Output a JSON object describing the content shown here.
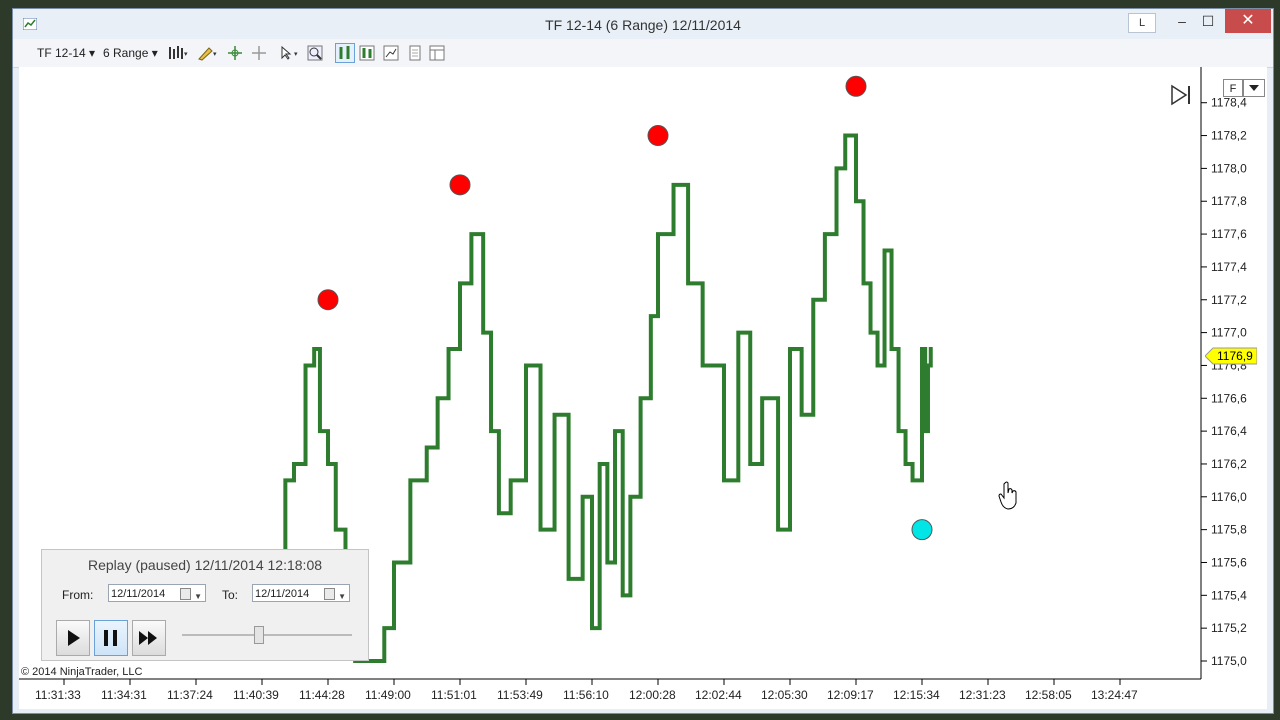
{
  "window": {
    "title": "TF 12-14 (6 Range)  12/11/2014",
    "layout_button": "L",
    "minimize": "‒",
    "maximize": "☐",
    "close": "✕"
  },
  "toolbar": {
    "instrument": "TF 12-14",
    "period": "6 Range",
    "icons": [
      "bars-type-icon",
      "drawing-pencil-icon",
      "crosshair-icon",
      "global-crosshair-icon",
      "pointer-icon",
      "zoom-icon",
      "chart-style-icon",
      "indicators-icon",
      "strategies-icon",
      "data-box-icon",
      "properties-icon"
    ]
  },
  "replay": {
    "title": "Replay (paused) 12/11/2014 12:18:08",
    "from_label": "From:",
    "from_value": "12/11/2014",
    "to_label": "To:",
    "to_value": "12/11/2014",
    "speed_fraction": 0.45
  },
  "chart": {
    "copyright": "© 2014 NinjaTrader, LLC",
    "last_price": "1176,9",
    "f_button": "F"
  },
  "chart_data": {
    "type": "line",
    "style": "line-on-close stepped",
    "series_color": "#2e7d2e",
    "y_ticks": [
      "1178,4",
      "1178,2",
      "1178,0",
      "1177,8",
      "1177,6",
      "1177,4",
      "1177,2",
      "1177,0",
      "1176,8",
      "1176,6",
      "1176,4",
      "1176,2",
      "1176,0",
      "1175,8",
      "1175,6",
      "1175,4",
      "1175,2",
      "1175,0"
    ],
    "x_ticks": [
      "11:31:33",
      "11:34:31",
      "11:37:24",
      "11:40:39",
      "11:44:28",
      "11:49:00",
      "11:51:01",
      "11:53:49",
      "11:56:10",
      "12:00:28",
      "12:02:44",
      "12:05:30",
      "12:09:17",
      "12:15:34",
      "12:31:23",
      "12:58:05",
      "13:24:47"
    ],
    "ylim": [
      1175.0,
      1178.5
    ],
    "points": [
      [
        "11:40:39",
        1175.0
      ],
      [
        "11:41:10",
        1175.4
      ],
      [
        "11:42:00",
        1175.6
      ],
      [
        "11:42:30",
        1176.1
      ],
      [
        "11:43:10",
        1176.2
      ],
      [
        "11:43:40",
        1176.8
      ],
      [
        "11:44:00",
        1176.9
      ],
      [
        "11:44:28",
        1176.4
      ],
      [
        "11:45:00",
        1176.2
      ],
      [
        "11:45:40",
        1175.8
      ],
      [
        "11:46:20",
        1175.2
      ],
      [
        "11:47:00",
        1175.0
      ],
      [
        "11:48:20",
        1175.0
      ],
      [
        "11:49:00",
        1175.2
      ],
      [
        "11:49:30",
        1175.6
      ],
      [
        "11:50:00",
        1176.1
      ],
      [
        "11:50:20",
        1176.3
      ],
      [
        "11:50:40",
        1176.6
      ],
      [
        "11:51:01",
        1176.9
      ],
      [
        "11:51:30",
        1177.3
      ],
      [
        "11:52:00",
        1177.6
      ],
      [
        "11:52:20",
        1177.0
      ],
      [
        "11:52:40",
        1176.4
      ],
      [
        "11:53:10",
        1175.9
      ],
      [
        "11:53:49",
        1176.1
      ],
      [
        "11:54:20",
        1176.8
      ],
      [
        "11:54:50",
        1175.8
      ],
      [
        "11:55:20",
        1176.5
      ],
      [
        "11:55:50",
        1175.5
      ],
      [
        "11:56:10",
        1176.0
      ],
      [
        "11:56:40",
        1175.2
      ],
      [
        "11:57:10",
        1176.2
      ],
      [
        "11:57:40",
        1175.6
      ],
      [
        "11:58:10",
        1176.4
      ],
      [
        "11:58:40",
        1175.4
      ],
      [
        "11:59:20",
        1176.0
      ],
      [
        "12:00:00",
        1176.6
      ],
      [
        "12:00:28",
        1177.1
      ],
      [
        "12:01:00",
        1177.6
      ],
      [
        "12:01:30",
        1177.9
      ],
      [
        "12:02:00",
        1177.3
      ],
      [
        "12:02:44",
        1176.8
      ],
      [
        "12:03:20",
        1176.1
      ],
      [
        "12:03:50",
        1177.0
      ],
      [
        "12:04:20",
        1176.2
      ],
      [
        "12:05:00",
        1176.6
      ],
      [
        "12:05:30",
        1175.8
      ],
      [
        "12:06:10",
        1176.9
      ],
      [
        "12:06:50",
        1176.5
      ],
      [
        "12:07:30",
        1177.2
      ],
      [
        "12:08:10",
        1177.6
      ],
      [
        "12:08:40",
        1178.0
      ],
      [
        "12:09:17",
        1178.2
      ],
      [
        "12:10:00",
        1177.8
      ],
      [
        "12:10:40",
        1177.3
      ],
      [
        "12:11:20",
        1177.0
      ],
      [
        "12:12:00",
        1176.8
      ],
      [
        "12:12:40",
        1177.5
      ],
      [
        "12:13:20",
        1176.9
      ],
      [
        "12:14:00",
        1176.4
      ],
      [
        "12:14:40",
        1176.2
      ],
      [
        "12:15:34",
        1176.1
      ],
      [
        "12:16:20",
        1176.9
      ],
      [
        "12:17:00",
        1176.4
      ],
      [
        "12:17:40",
        1176.8
      ],
      [
        "12:18:08",
        1176.9
      ]
    ],
    "markers": [
      {
        "x": "11:44:28",
        "y": 1177.2,
        "color": "#ff0000",
        "kind": "swing-high"
      },
      {
        "x": "11:51:01",
        "y": 1177.9,
        "color": "#ff0000",
        "kind": "swing-high"
      },
      {
        "x": "12:00:28",
        "y": 1178.2,
        "color": "#ff0000",
        "kind": "swing-high"
      },
      {
        "x": "12:09:17",
        "y": 1178.5,
        "color": "#ff0000",
        "kind": "swing-high"
      },
      {
        "x": "12:15:34",
        "y": 1175.8,
        "color": "#00e5e5",
        "kind": "swing-low"
      }
    ],
    "title": "",
    "xlabel": "",
    "ylabel": "",
    "grid": false
  }
}
